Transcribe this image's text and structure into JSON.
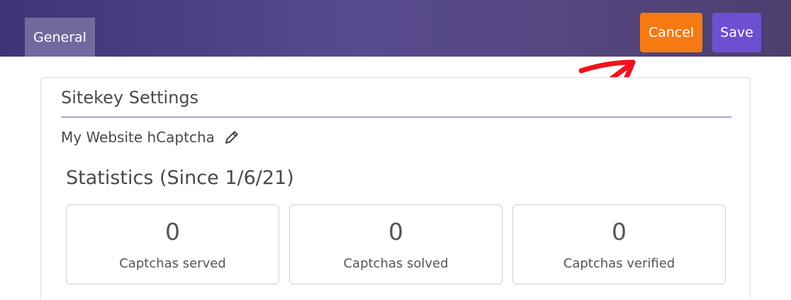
{
  "header": {
    "tab_label": "General",
    "cancel_label": "Cancel",
    "save_label": "Save"
  },
  "card": {
    "title": "Sitekey Settings",
    "site_name": "My Website hCaptcha",
    "stats_title": "Statistics (Since 1/6/21)",
    "stats": [
      {
        "value": "0",
        "label": "Captchas served"
      },
      {
        "value": "0",
        "label": "Captchas solved"
      },
      {
        "value": "0",
        "label": "Captchas verified"
      }
    ]
  },
  "icons": {
    "edit": "pencil-icon",
    "annotation": "red-arrow-annotation"
  },
  "colors": {
    "header_bg": "#4f4385",
    "tab_active_bg": "#74699f",
    "cancel_bg": "#f57a12",
    "save_bg": "#6e4fd2",
    "divider": "#6a5cc8",
    "annotation": "#f2121e"
  }
}
